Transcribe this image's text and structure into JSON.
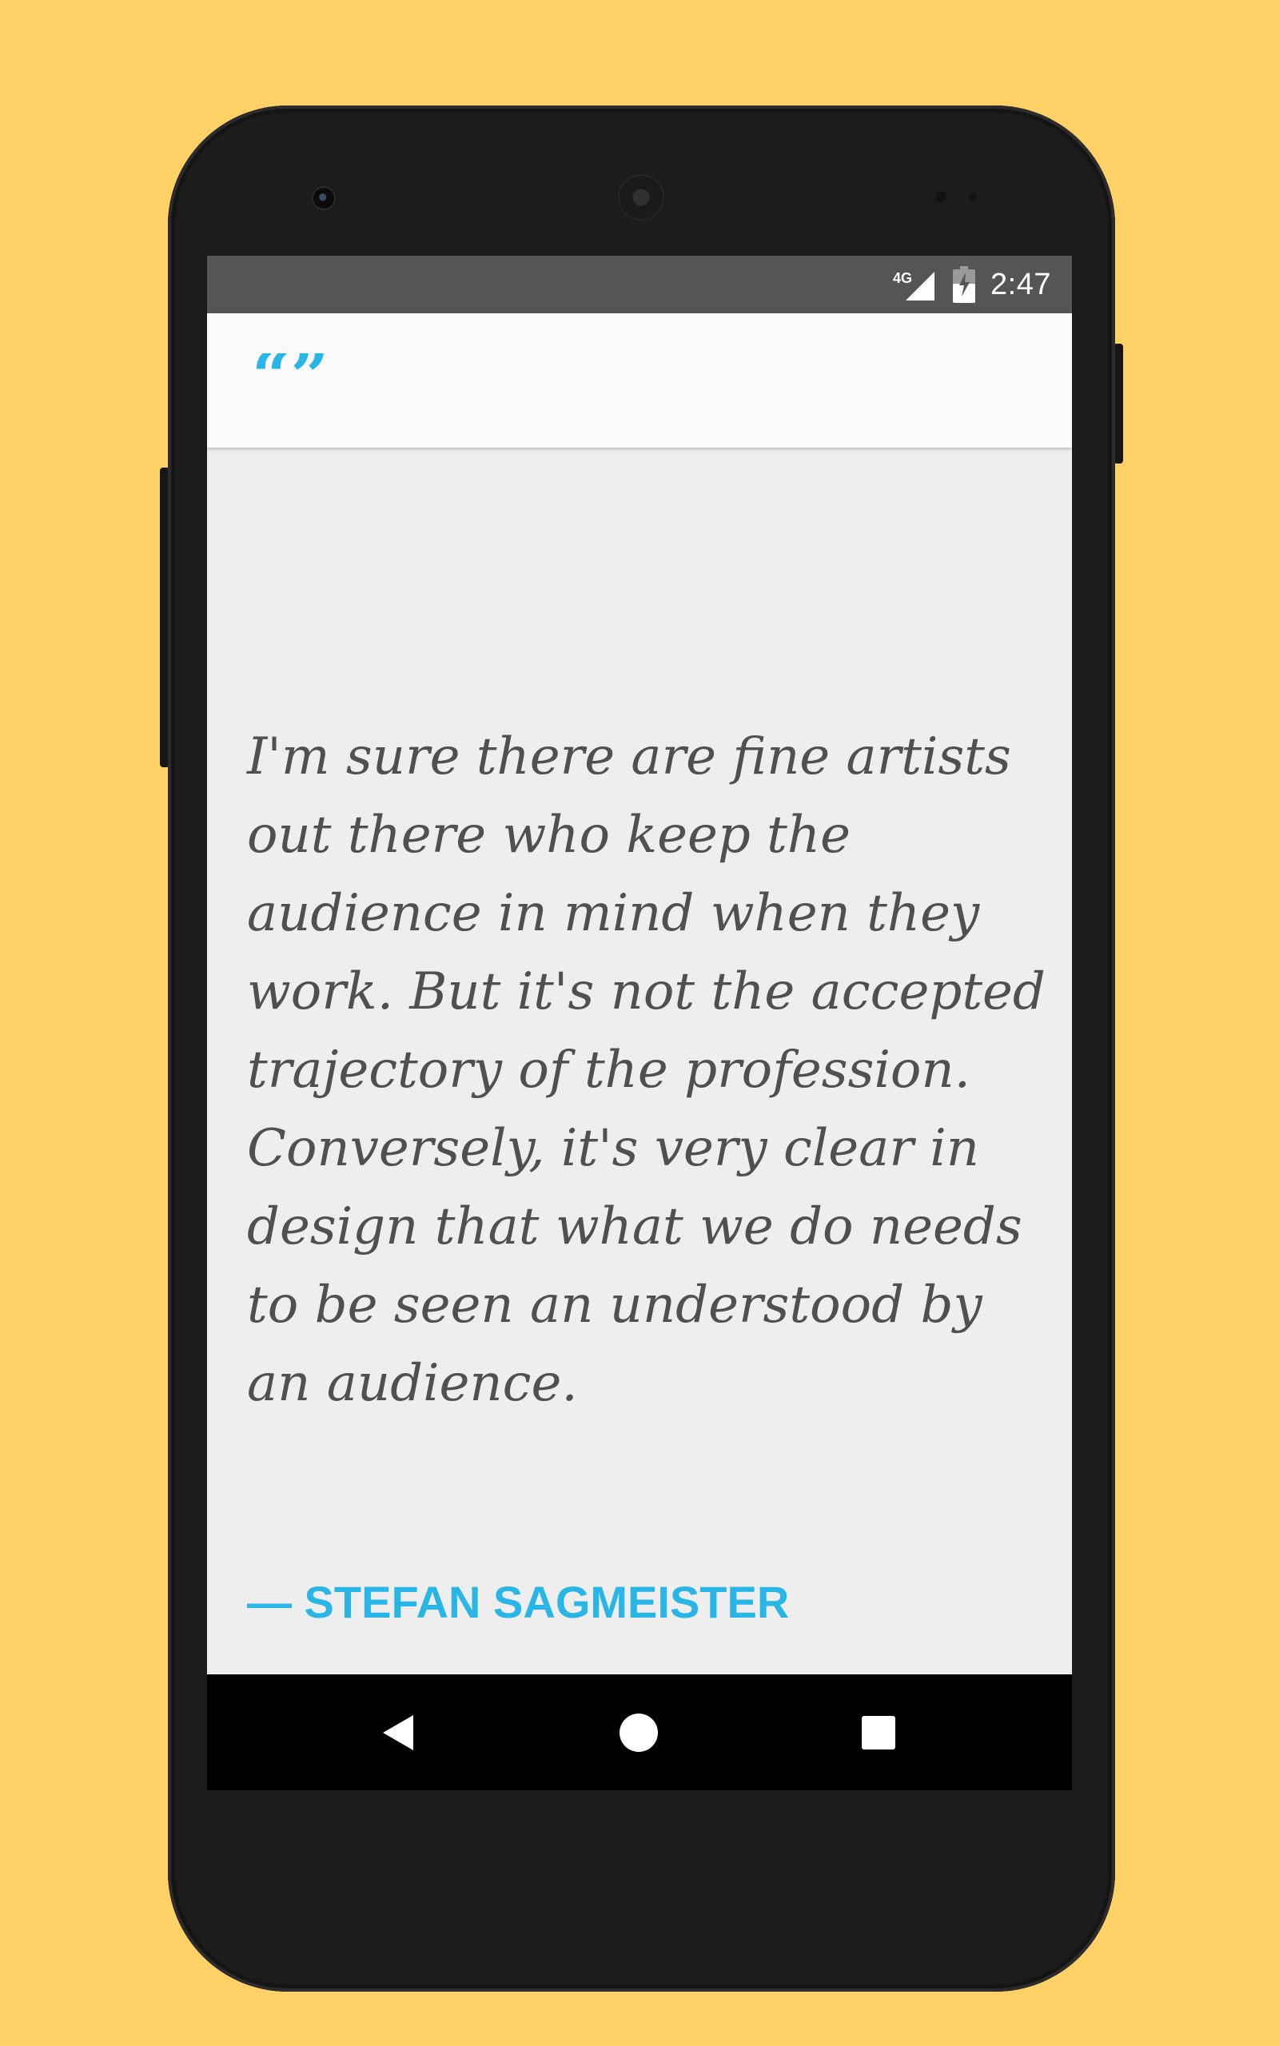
{
  "status_bar": {
    "network_label": "4G",
    "time": "2:47",
    "icons": [
      "signal-icon",
      "battery-icon"
    ]
  },
  "app_bar": {
    "logo_icon": "quote-marks-icon",
    "accent_color": "#29b6e6"
  },
  "quote": {
    "text": "I'm sure there are fine artists out there who keep the audience in mind when they work. But it's not the accepted trajectory of the profession. Conversely, it's very clear in design that what we do needs to be seen an understood by an audience.",
    "author": "— STEFAN SAGMEISTER"
  },
  "nav_bar": {
    "buttons": [
      "back-icon",
      "home-icon",
      "recents-icon"
    ]
  },
  "colors": {
    "background": "#ffd166",
    "status_bar": "#555555",
    "app_bar": "#fafafa",
    "content_background": "#eeeeee",
    "quote_text": "#505050",
    "accent": "#29b6e6",
    "nav_bar": "#000000"
  }
}
